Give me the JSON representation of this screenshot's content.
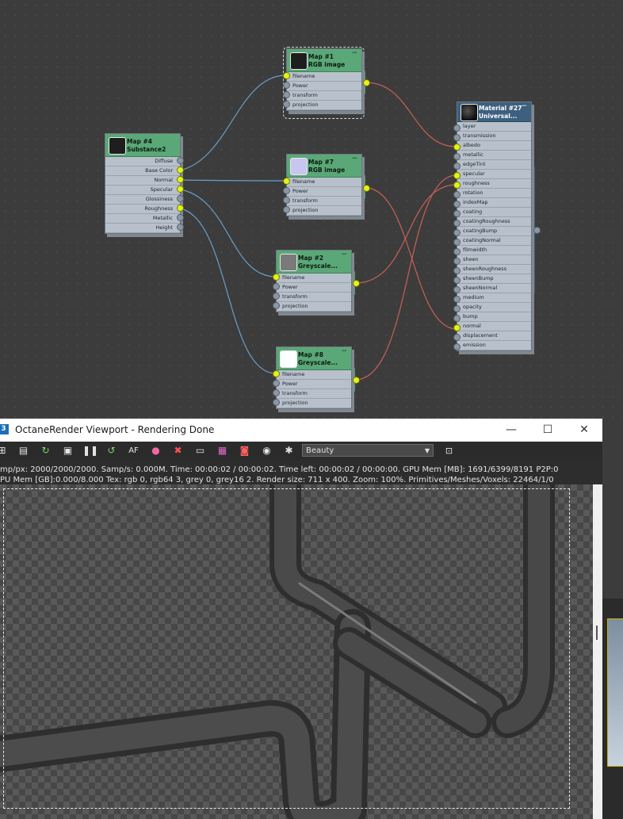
{
  "graph": {
    "nodes": {
      "map1": {
        "title": "Map #1",
        "subtitle": "RGB image",
        "ports": [
          "filename",
          "Power",
          "transform",
          "projection"
        ]
      },
      "map4": {
        "title": "Map #4",
        "subtitle": "Substance2",
        "ports": [
          "Diffuse",
          "Base Color",
          "Normal",
          "Specular",
          "Glossiness",
          "Roughness",
          "Metallic",
          "Height"
        ]
      },
      "map7": {
        "title": "Map #7",
        "subtitle": "RGB image",
        "ports": [
          "filename",
          "Power",
          "transform",
          "projection"
        ]
      },
      "map2": {
        "title": "Map #2",
        "subtitle": "Greyscale...",
        "ports": [
          "filename",
          "Power",
          "transform",
          "projection"
        ]
      },
      "map8": {
        "title": "Map #8",
        "subtitle": "Greyscale...",
        "ports": [
          "filename",
          "Power",
          "transform",
          "projection"
        ]
      },
      "mat27": {
        "title": "Material #27",
        "subtitle": "Universal...",
        "ports": [
          "layer",
          "transmission",
          "albedo",
          "metallic",
          "edgeTint",
          "specular",
          "roughness",
          "rotation",
          "indexMap",
          "coating",
          "coatingRoughness",
          "coatingBump",
          "coatingNormal",
          "filmwidth",
          "sheen",
          "sheenRoughness",
          "sheenBump",
          "sheenNormal",
          "medium",
          "opacity",
          "bump",
          "normal",
          "displacement",
          "emission"
        ]
      }
    },
    "minimize_glyph": "−",
    "colors": {
      "node_header": "#5aa877",
      "material_header": "#3d607f",
      "node_body": "#b8c1cb",
      "input_wire": "#6a9ec8",
      "output_wire": "#c86058",
      "socket_active": "#e2f21a"
    }
  },
  "viewport": {
    "window_title": "OctaneRender Viewport - Rendering Done",
    "app_icon": "3",
    "window_buttons": {
      "minimize": "—",
      "maximize": "☐",
      "close": "✕"
    },
    "pass_selector": "Beauty",
    "stats_line1": "mp/px: 2000/2000/2000.   Samp/s: 0.000M.   Time: 00:00:02 / 00:00:02.   Time left: 00:00:02 / 00:00:00.   GPU Mem [MB]: 1691/6399/8191 P2P:0",
    "stats_line2": "PU Mem [GB]:0.000/8.000   Tex: rgb 0, rgb64 3, grey 0, grey16 2.   Render size: 711 x 400.   Zoom: 100%.   Primitives/Meshes/Voxels: 22464/1/0",
    "toolbar_icons": [
      "send-scene-icon",
      "clipboard-icon",
      "restart-icon",
      "lock-icon",
      "pause-icon",
      "refresh-icon",
      "focus-picker-icon",
      "color-picker-icon",
      "material-picker-icon",
      "region-icon",
      "save-icon",
      "camera-icon",
      "snapshot-icon",
      "settings-icon",
      "image-options-icon"
    ]
  }
}
